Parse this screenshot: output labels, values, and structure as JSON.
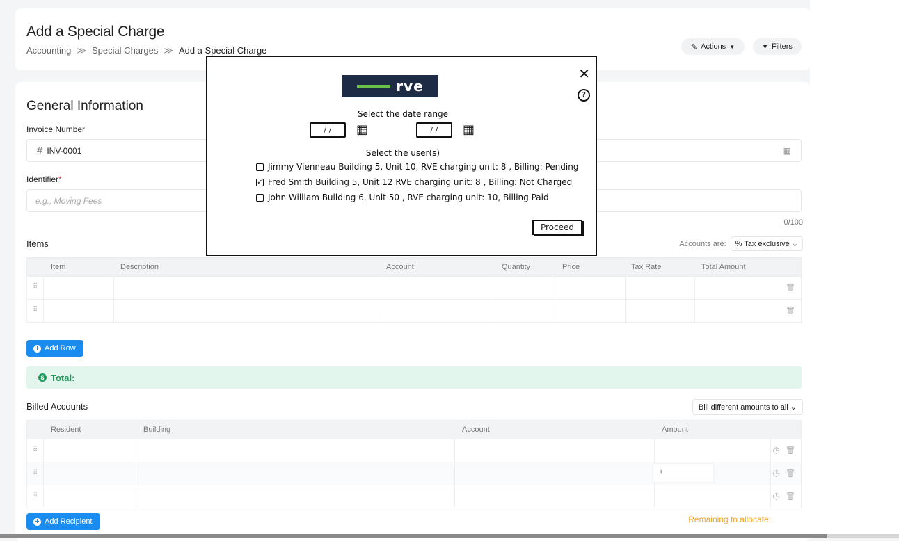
{
  "header": {
    "title": "Add a Special Charge",
    "breadcrumb": [
      "Accounting",
      "Special Charges",
      "Add a Special Charge"
    ],
    "breadcrumb_sep": "≫",
    "actions_label": "Actions",
    "filters_label": "Filters"
  },
  "general": {
    "title": "General Information",
    "invoice_label": "Invoice Number",
    "invoice_value": "INV-0001",
    "identifier_label": "Identifier",
    "identifier_required": "*",
    "identifier_placeholder": "e.g., Moving Fees",
    "identifier_counter": "0/100"
  },
  "items": {
    "title": "Items",
    "accounts_are_label": "Accounts are:",
    "tax_mode": "Tax exclusive",
    "columns": [
      "Item",
      "Description",
      "Account",
      "Quantity",
      "Price",
      "Tax Rate",
      "Total Amount"
    ],
    "add_row_label": "Add Row",
    "total_label": "Total:"
  },
  "billed": {
    "title": "Billed Accounts",
    "bill_mode": "Bill different amounts to all",
    "columns": [
      "Resident",
      "Building",
      "Account",
      "Amount"
    ],
    "amount_row2": "!",
    "add_recipient_label": "Add Recipient",
    "remaining_label": "Remaining to allocate:"
  },
  "modal": {
    "logo_text": "rve",
    "date_range_label": "Select the date range",
    "date_placeholder": "/ /",
    "users_label": "Select the user(s)",
    "users": [
      {
        "text": "Jimmy Vienneau Building 5, Unit 10, RVE charging unit: 8  , Billing: Pending",
        "checked": false
      },
      {
        "text": "Fred Smith Building 5, Unit 12  RVE charging unit: 8 , Billing: Not Charged",
        "checked": true
      },
      {
        "text": "John William Building 6, Unit 50 , RVE charging unit: 10, Billing Paid",
        "checked": false
      }
    ],
    "proceed_label": "Proceed",
    "close_glyph": "✕",
    "help_glyph": "?"
  },
  "icons": {
    "hash": "#",
    "calendar": "▦",
    "check": "✓",
    "drag": "⠿",
    "trash": "🗑",
    "clock": "◷",
    "plus": "+",
    "dollar": "$",
    "caret": "⌄",
    "pen": "✎",
    "funnel": "▼"
  },
  "colors": {
    "accent": "#1a8cf0",
    "total_bg": "#e3f6ee",
    "total_text": "#1a9c5b",
    "remaining": "#f5a623",
    "logo_bg": "#1e2b45",
    "logo_bar": "#6cc04a"
  }
}
